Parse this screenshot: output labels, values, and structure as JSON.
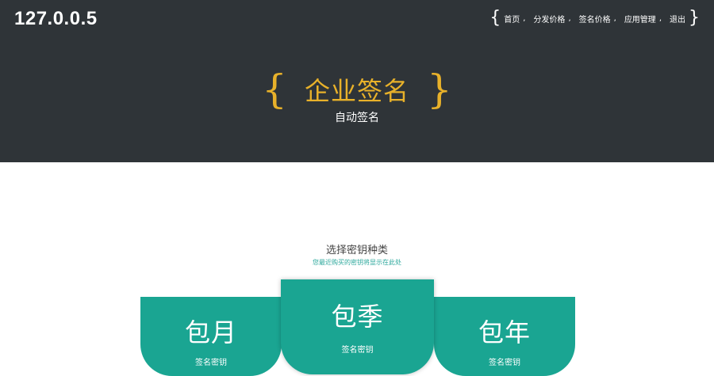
{
  "header": {
    "logo": "127.0.0.5",
    "nav": {
      "open_brace": "{",
      "close_brace": "}",
      "items": [
        {
          "label": "首页",
          "sep": ","
        },
        {
          "label": "分发价格",
          "sep": ","
        },
        {
          "label": "签名价格",
          "sep": ","
        },
        {
          "label": "应用管理",
          "sep": ","
        },
        {
          "label": "退出",
          "sep": ""
        }
      ]
    }
  },
  "hero": {
    "bracket_left": "{",
    "title": "企业签名",
    "bracket_right": "}",
    "subtitle": "自动签名"
  },
  "section": {
    "title": "选择密钥种类",
    "hint": "您最近购买的密钥将显示在此处"
  },
  "cards": [
    {
      "name": "包月",
      "desc": "签名密钥"
    },
    {
      "name": "包季",
      "desc": "签名密钥"
    },
    {
      "name": "包年",
      "desc": "签名密钥"
    }
  ],
  "colors": {
    "header_bg": "#2f3438",
    "accent_gold": "#e8b12a",
    "card_teal": "#1aa592"
  }
}
